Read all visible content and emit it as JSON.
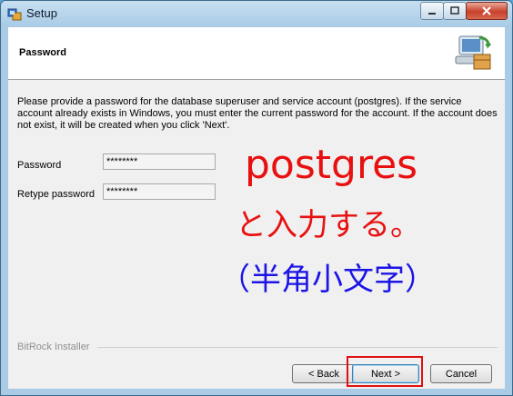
{
  "window": {
    "title": "Setup"
  },
  "header": {
    "title": "Password"
  },
  "description": "Please provide a password for the database superuser and service account (postgres). If the service account already exists in Windows, you must enter the current password for the account. If the account does not exist, it will be created when you click 'Next'.",
  "form": {
    "password_label": "Password",
    "password_value": "********",
    "retype_label": "Retype password",
    "retype_value": "********"
  },
  "annotation": {
    "line1": "postgres",
    "line2": "と入力する。",
    "line3": "（半角小文字）",
    "colors": {
      "red": "#e81010",
      "blue": "#1c14e6"
    }
  },
  "footer": {
    "brand": "BitRock Installer"
  },
  "buttons": {
    "back": "< Back",
    "next": "Next >",
    "cancel": "Cancel"
  },
  "icons": [
    "setup-app-icon",
    "minimize-icon",
    "maximize-icon",
    "close-icon",
    "computer-package-icon"
  ]
}
